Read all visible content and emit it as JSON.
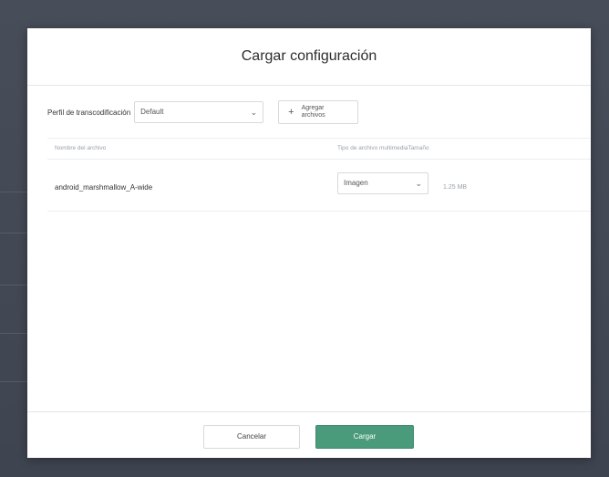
{
  "dialog": {
    "title": "Cargar configuración"
  },
  "profile": {
    "label": "Perfil de transcodificación",
    "value": "Default"
  },
  "add_files": {
    "label_line1": "Agregar",
    "label_line2": "archivos"
  },
  "table": {
    "columns": [
      "Nombre del archivo",
      "Tipo de archivo multimedia",
      "Tamaño"
    ],
    "rows": [
      {
        "name": "android_marshmallow_A-wide",
        "type": "Imagen",
        "size": "1.25 MB"
      }
    ]
  },
  "footer": {
    "cancel_label": "Cancelar",
    "load_label": "Cargar"
  },
  "colors": {
    "primary_button": "#4a9b7c",
    "backdrop": "#3f4551"
  }
}
